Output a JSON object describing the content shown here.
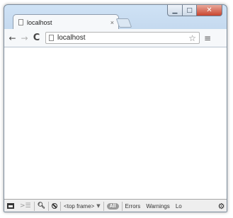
{
  "window": {
    "minimize_glyph": "▁",
    "maximize_glyph": "□",
    "close_glyph": "✕"
  },
  "tab": {
    "title": "localhost",
    "close_glyph": "×"
  },
  "toolbar": {
    "back_glyph": "←",
    "forward_glyph": "→",
    "reload_glyph": "C",
    "url": "localhost",
    "star_glyph": "☆",
    "menu_glyph": "≡"
  },
  "devtools": {
    "drawer_glyph": ">☰",
    "search_glyph": "🔍︎",
    "frame_selector": "<top frame>",
    "frame_caret": "▼",
    "filter_all": "All",
    "filter_errors": "Errors",
    "filter_warnings": "Warnings",
    "filter_logs_truncated": "Lo",
    "settings_glyph": "⚙"
  },
  "colors": {
    "frame": "#c3d8ee",
    "close_button": "#c9452f",
    "devtools_bar": "#eeeeee"
  }
}
